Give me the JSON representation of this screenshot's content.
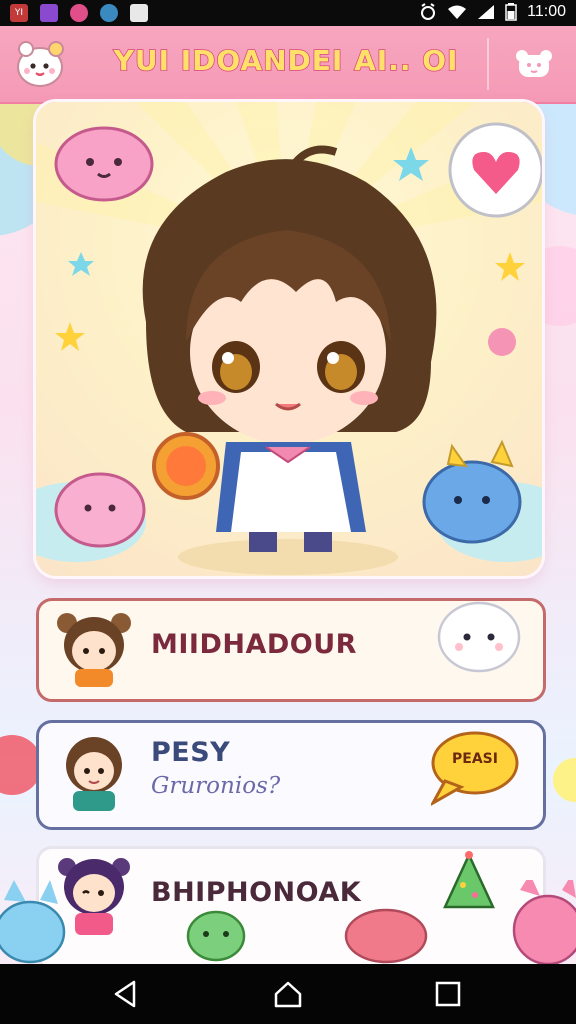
{
  "status_bar": {
    "time": "11:00",
    "apps": [
      "app-icon-1",
      "gallery-icon",
      "app-icon-2",
      "shield-icon",
      "image-icon"
    ],
    "icons": [
      "alarm-icon",
      "wifi-icon",
      "signal-icon",
      "battery-icon"
    ]
  },
  "header": {
    "title": "YUI IDOANDEI AI.. OI",
    "logo_icon": "mascot-logo-icon",
    "menu_icon": "bear-face-icon"
  },
  "hero": {
    "character": "chibi-girl-illustration",
    "speech_icon": "heart-bubble-icon"
  },
  "list": [
    {
      "title": "MIIDHADOUR",
      "subtitle": "",
      "avatar": "bear-ear-boy-avatar",
      "accessory": "ghost-icon"
    },
    {
      "title": "PESY",
      "subtitle": "Gruronios?",
      "avatar": "green-shirt-boy-avatar",
      "accessory": "speech-bubble-icon",
      "bubble_text": "PEASI"
    },
    {
      "title": "BHIPHONOAK",
      "subtitle": "",
      "avatar": "purple-hair-girl-avatar",
      "accessory": "party-hat-icon"
    }
  ],
  "nav": {
    "back": "back-icon",
    "home": "home-icon",
    "recents": "recents-icon"
  },
  "colors": {
    "header": "#f59ab6",
    "title_fill": "#ffe16a",
    "title_stroke": "#d9467a",
    "item_title": "#7a2a3c"
  }
}
